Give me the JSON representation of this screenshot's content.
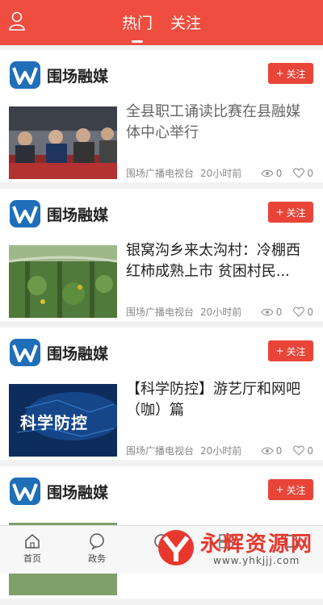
{
  "header": {
    "tabs": [
      {
        "label": "热门",
        "active": true
      },
      {
        "label": "关注",
        "active": false
      }
    ]
  },
  "colors": {
    "brand": "#ef4d3f",
    "follow_button": "#e94438"
  },
  "feed": [
    {
      "source": "围场融媒",
      "follow": "关注",
      "title": "全县职工诵读比赛在县融媒体中心举行",
      "title_read": true,
      "channel": "围场广播电视台",
      "time": "20小时前",
      "views": "0",
      "likes": "0",
      "thumb": "meeting"
    },
    {
      "source": "围场融媒",
      "follow": "关注",
      "title": "银窝沟乡来太沟村：冷棚西红柿成熟上市 贫困村民...",
      "title_read": false,
      "channel": "围场广播电视台",
      "time": "20小时前",
      "views": "0",
      "likes": "0",
      "thumb": "greenhouse"
    },
    {
      "source": "围场融媒",
      "follow": "关注",
      "title": "【科学防控】游艺厅和网吧（咖）篇",
      "title_read": false,
      "channel": "围场广播电视台",
      "time": "20小时前",
      "views": "0",
      "likes": "0",
      "thumb": "science",
      "thumb_text": "科学防控"
    },
    {
      "source": "围场融媒",
      "follow": "关注",
      "title": "",
      "title_read": false,
      "channel": "",
      "time": "",
      "views": "",
      "likes": "",
      "thumb": "partial"
    }
  ],
  "tabbar": {
    "items": [
      {
        "label": "首页",
        "icon": "home-icon"
      },
      {
        "label": "政务",
        "icon": "chat-icon"
      },
      {
        "label": "",
        "icon": "center-icon"
      },
      {
        "label": "",
        "icon": "grid-icon"
      },
      {
        "label": "",
        "icon": "service-icon"
      }
    ]
  },
  "watermark": {
    "text": "永辉资源网",
    "url": "www.yhkjjj.com"
  }
}
